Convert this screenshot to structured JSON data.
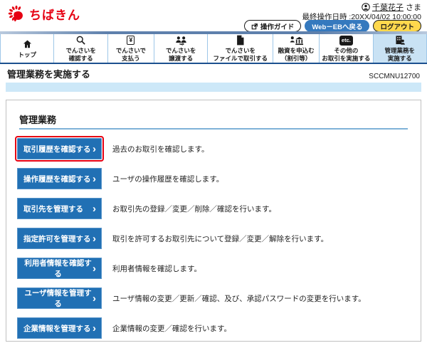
{
  "header": {
    "logo_text": "ちばきん",
    "user_name": "千葉花子",
    "user_suffix": "さま",
    "last_operation": "最終操作日時 :20XX/04/02 10:00:00",
    "guide_button": "操作ガイド",
    "web_eb_button": "Web－EBへ戻る",
    "logout_button": "ログアウト"
  },
  "nav": {
    "yen_glyph": "¥",
    "etc_glyph": "etc.",
    "items": [
      {
        "line1": "トップ",
        "line2": ""
      },
      {
        "line1": "でんさいを",
        "line2": "確認する"
      },
      {
        "line1": "でんさいで",
        "line2": "支払う"
      },
      {
        "line1": "でんさいを",
        "line2": "譲渡する"
      },
      {
        "line1": "でんさいを",
        "line2": "ファイルで取引する"
      },
      {
        "line1": "融資を申込む",
        "line2": "（割引等）"
      },
      {
        "line1": "その他の",
        "line2": "お取引を実施する"
      },
      {
        "line1": "管理業務を",
        "line2": "実施する"
      }
    ]
  },
  "page": {
    "title": "管理業務を実施する",
    "screen_id": "SCCMNU12700"
  },
  "main": {
    "section_title": "管理業務",
    "chevron": "›",
    "menu_items": [
      {
        "button": "取引履歴を確認する",
        "description": "過去のお取引を確認します。"
      },
      {
        "button": "操作履歴を確認する",
        "description": "ユーザの操作履歴を確認します。"
      },
      {
        "button": "取引先を管理する",
        "description": "お取引先の登録／変更／削除／確認を行います。"
      },
      {
        "button": "指定許可を管理する",
        "description": "取引を許可するお取引先について登録／変更／解除を行います。"
      },
      {
        "button": "利用者情報を確認する",
        "description": "利用者情報を確認します。"
      },
      {
        "button": "ユーザ情報を管理する",
        "description": "ユーザ情報の変更／更新／確認、及び、承認パスワードの変更を行います。"
      },
      {
        "button": "企業情報を管理する",
        "description": "企業情報の変更／確認を行います。"
      }
    ]
  },
  "colors": {
    "brand_red": "#e60012",
    "button_blue": "#2170b4",
    "nav_active_bg": "#c9e2f4",
    "section_bar_blue": "#cde8f8",
    "highlight_red": "#e60012",
    "logout_yellow": "#ffd84d",
    "webeb_blue": "#3579be",
    "nav_border_navy": "#1c508f"
  }
}
